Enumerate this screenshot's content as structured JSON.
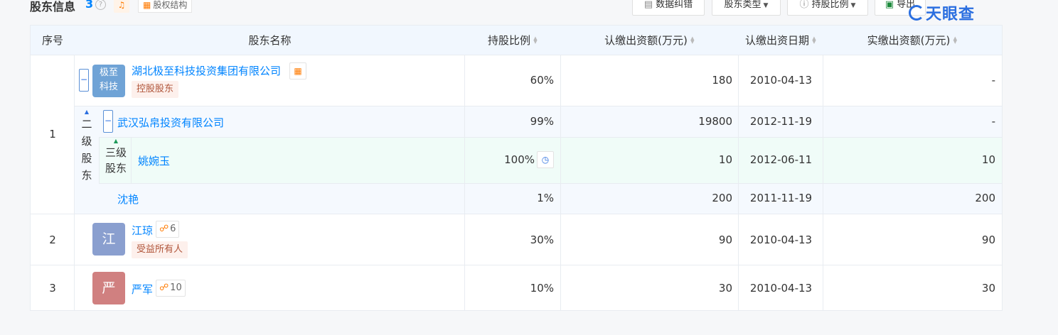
{
  "header": {
    "title": "股东信息",
    "count": "3",
    "help_glyph": "?",
    "equity_button": "股权结构",
    "buttons": {
      "data_correction": "数据纠错",
      "shareholder_type": "股东类型",
      "share_ratio": "持股比例",
      "export": "导出"
    },
    "logo": "天眼查"
  },
  "columns": {
    "index": "序号",
    "name": "股东名称",
    "ratio": "持股比例",
    "subscribed_amount": "认缴出资额(万元)",
    "subscribed_date": "认缴出资日期",
    "paid_amount": "实缴出资额(万元)"
  },
  "rows": [
    {
      "index": "1",
      "avatar_text_1": "极至",
      "avatar_text_2": "科技",
      "name": "湖北极至科技投资集团有限公司",
      "tag": "控股股东",
      "ratio": "60%",
      "subscribed_amount": "180",
      "subscribed_date": "2010-04-13",
      "paid_amount": "-",
      "level2_label_1": "二",
      "level2_label_2": "级",
      "level2_label_3": "股",
      "level2_label_4": "东",
      "sub": {
        "name": "武汉弘帛投资有限公司",
        "ratio": "99%",
        "subscribed_amount": "19800",
        "subscribed_date": "2012-11-19",
        "paid_amount": "-",
        "level3_label_1": "三级",
        "level3_label_2": "股东",
        "subsub": {
          "name": "姚婉玉",
          "ratio": "100%",
          "subscribed_amount": "10",
          "subscribed_date": "2012-06-11",
          "paid_amount": "10"
        }
      },
      "sub2": {
        "name": "沈艳",
        "ratio": "1%",
        "subscribed_amount": "200",
        "subscribed_date": "2011-11-19",
        "paid_amount": "200"
      }
    },
    {
      "index": "2",
      "avatar_text": "江",
      "avatar_color": "#8a9fcf",
      "name": "江琼",
      "chain_count": "6",
      "tag": "受益所有人",
      "ratio": "30%",
      "subscribed_amount": "90",
      "subscribed_date": "2010-04-13",
      "paid_amount": "90"
    },
    {
      "index": "3",
      "avatar_text": "严",
      "avatar_color": "#d08080",
      "name": "严军",
      "chain_count": "10",
      "ratio": "10%",
      "subscribed_amount": "30",
      "subscribed_date": "2010-04-13",
      "paid_amount": "30"
    }
  ]
}
